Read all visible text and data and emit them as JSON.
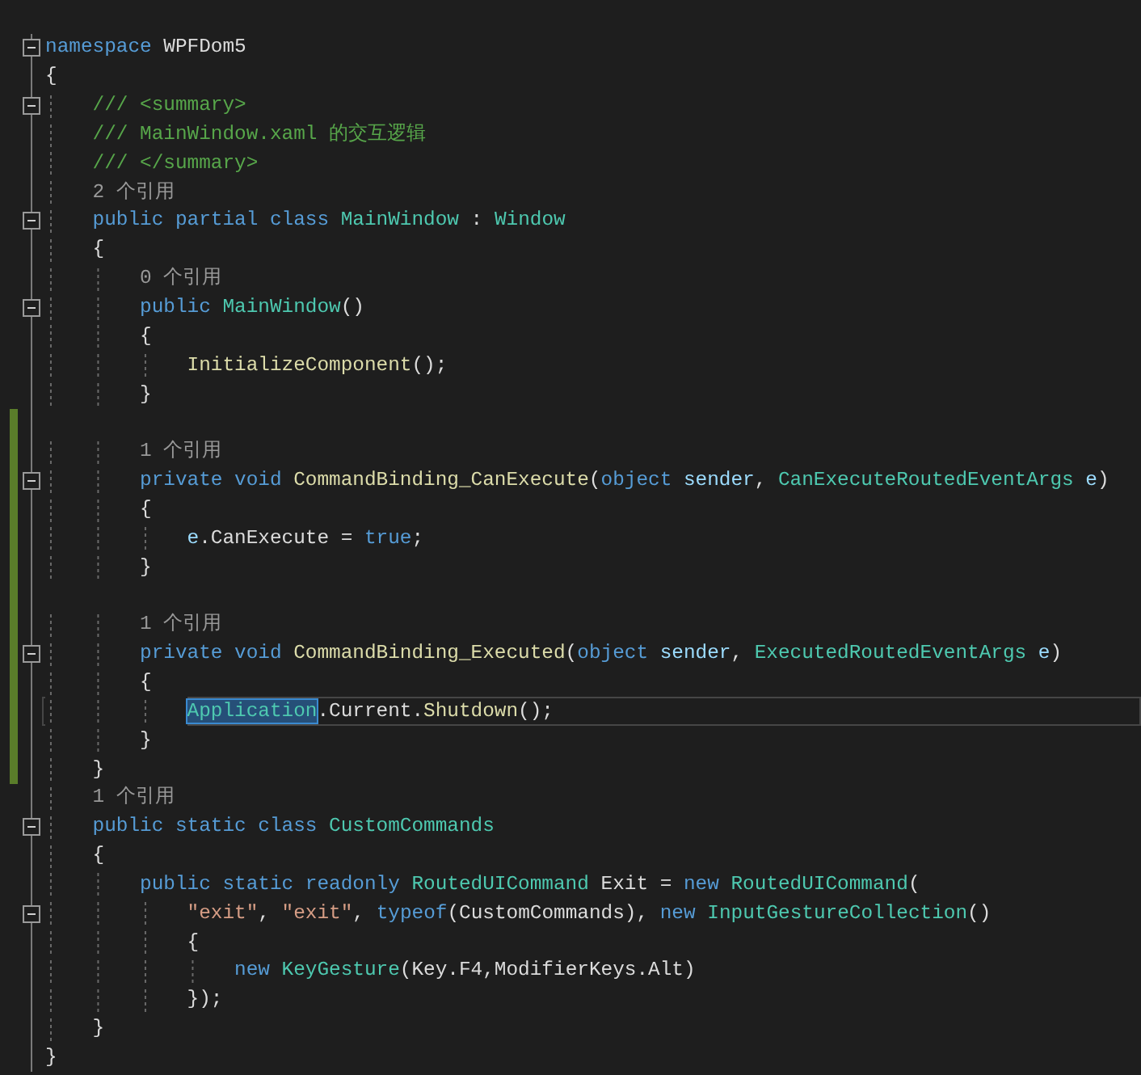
{
  "editor": {
    "lines": [
      {
        "fold": true,
        "changed": false,
        "current": false,
        "tokens": [
          {
            "kind": "kw",
            "text": "namespace"
          },
          {
            "kind": "plain",
            "text": " WPFDom5"
          }
        ]
      },
      {
        "fold": false,
        "changed": false,
        "current": false,
        "tokens": [
          {
            "kind": "plain",
            "text": "{"
          }
        ]
      },
      {
        "fold": true,
        "changed": false,
        "current": false,
        "tokens": [
          {
            "kind": "comment",
            "text": "    /// <summary>"
          }
        ]
      },
      {
        "fold": false,
        "changed": false,
        "current": false,
        "tokens": [
          {
            "kind": "comment",
            "text": "    /// MainWindow.xaml 的交互逻辑"
          }
        ]
      },
      {
        "fold": false,
        "changed": false,
        "current": false,
        "tokens": [
          {
            "kind": "comment",
            "text": "    /// </summary>"
          }
        ]
      },
      {
        "fold": false,
        "changed": false,
        "current": false,
        "tokens": [
          {
            "kind": "lens",
            "text": "    2 个引用"
          }
        ]
      },
      {
        "fold": true,
        "changed": false,
        "current": false,
        "tokens": [
          {
            "kind": "kw",
            "text": "    public partial class "
          },
          {
            "kind": "type",
            "text": "MainWindow"
          },
          {
            "kind": "plain",
            "text": " : "
          },
          {
            "kind": "type",
            "text": "Window"
          }
        ]
      },
      {
        "fold": false,
        "changed": false,
        "current": false,
        "tokens": [
          {
            "kind": "plain",
            "text": "    {"
          }
        ]
      },
      {
        "fold": false,
        "changed": false,
        "current": false,
        "tokens": [
          {
            "kind": "lens",
            "text": "        0 个引用"
          }
        ]
      },
      {
        "fold": true,
        "changed": false,
        "current": false,
        "tokens": [
          {
            "kind": "kw",
            "text": "        public "
          },
          {
            "kind": "type",
            "text": "MainWindow"
          },
          {
            "kind": "plain",
            "text": "()"
          }
        ]
      },
      {
        "fold": false,
        "changed": false,
        "current": false,
        "tokens": [
          {
            "kind": "plain",
            "text": "        {"
          }
        ]
      },
      {
        "fold": false,
        "changed": false,
        "current": false,
        "tokens": [
          {
            "kind": "method",
            "text": "            InitializeComponent"
          },
          {
            "kind": "plain",
            "text": "();"
          }
        ]
      },
      {
        "fold": false,
        "changed": false,
        "current": false,
        "tokens": [
          {
            "kind": "plain",
            "text": "        }"
          }
        ]
      },
      {
        "fold": false,
        "changed": true,
        "current": false
      },
      {
        "fold": false,
        "changed": true,
        "current": false,
        "tokens": [
          {
            "kind": "lens",
            "text": "        1 个引用"
          }
        ]
      },
      {
        "fold": true,
        "changed": true,
        "current": false,
        "tokens": [
          {
            "kind": "kw",
            "text": "        private void "
          },
          {
            "kind": "method",
            "text": "CommandBinding_CanExecute"
          },
          {
            "kind": "plain",
            "text": "("
          },
          {
            "kind": "kw",
            "text": "object "
          },
          {
            "kind": "param",
            "text": "sender"
          },
          {
            "kind": "plain",
            "text": ", "
          },
          {
            "kind": "type",
            "text": "CanExecuteRoutedEventArgs "
          },
          {
            "kind": "param",
            "text": "e"
          },
          {
            "kind": "plain",
            "text": ")"
          }
        ]
      },
      {
        "fold": false,
        "changed": true,
        "current": false,
        "tokens": [
          {
            "kind": "plain",
            "text": "        {"
          }
        ]
      },
      {
        "fold": false,
        "changed": true,
        "current": false,
        "tokens": [
          {
            "kind": "param",
            "text": "            e"
          },
          {
            "kind": "plain",
            "text": ".CanExecute = "
          },
          {
            "kind": "kw",
            "text": "true"
          },
          {
            "kind": "plain",
            "text": ";"
          }
        ]
      },
      {
        "fold": false,
        "changed": true,
        "current": false,
        "tokens": [
          {
            "kind": "plain",
            "text": "        }"
          }
        ]
      },
      {
        "fold": false,
        "changed": true,
        "current": false
      },
      {
        "fold": false,
        "changed": true,
        "current": false,
        "tokens": [
          {
            "kind": "lens",
            "text": "        1 个引用"
          }
        ]
      },
      {
        "fold": true,
        "changed": true,
        "current": false,
        "tokens": [
          {
            "kind": "kw",
            "text": "        private void "
          },
          {
            "kind": "method",
            "text": "CommandBinding_Executed"
          },
          {
            "kind": "plain",
            "text": "("
          },
          {
            "kind": "kw",
            "text": "object "
          },
          {
            "kind": "param",
            "text": "sender"
          },
          {
            "kind": "plain",
            "text": ", "
          },
          {
            "kind": "type",
            "text": "ExecutedRoutedEventArgs "
          },
          {
            "kind": "param",
            "text": "e"
          },
          {
            "kind": "plain",
            "text": ")"
          }
        ]
      },
      {
        "fold": false,
        "changed": true,
        "current": false,
        "tokens": [
          {
            "kind": "plain",
            "text": "        {"
          }
        ]
      },
      {
        "fold": false,
        "changed": true,
        "current": true,
        "tokens": [
          {
            "kind": "type",
            "text": "            Application",
            "highlighted": true
          },
          {
            "kind": "plain",
            "text": ".Current."
          },
          {
            "kind": "method",
            "text": "Shutdown"
          },
          {
            "kind": "plain",
            "text": "();"
          }
        ]
      },
      {
        "fold": false,
        "changed": true,
        "current": false,
        "tokens": [
          {
            "kind": "plain",
            "text": "        }"
          }
        ]
      },
      {
        "fold": false,
        "changed": true,
        "current": false,
        "tokens": [
          {
            "kind": "plain",
            "text": "    }"
          }
        ]
      },
      {
        "fold": false,
        "changed": false,
        "current": false,
        "tokens": [
          {
            "kind": "lens",
            "text": "    1 个引用"
          }
        ]
      },
      {
        "fold": true,
        "changed": false,
        "current": false,
        "tokens": [
          {
            "kind": "kw",
            "text": "    public static class "
          },
          {
            "kind": "type",
            "text": "CustomCommands"
          }
        ]
      },
      {
        "fold": false,
        "changed": false,
        "current": false,
        "tokens": [
          {
            "kind": "plain",
            "text": "    {"
          }
        ]
      },
      {
        "fold": false,
        "changed": false,
        "current": false,
        "tokens": [
          {
            "kind": "kw",
            "text": "        public static readonly "
          },
          {
            "kind": "type",
            "text": "RoutedUICommand"
          },
          {
            "kind": "plain",
            "text": " Exit = "
          },
          {
            "kind": "kw",
            "text": "new "
          },
          {
            "kind": "type",
            "text": "RoutedUICommand"
          },
          {
            "kind": "plain",
            "text": "("
          }
        ]
      },
      {
        "fold": true,
        "changed": false,
        "current": false,
        "tokens": [
          {
            "kind": "string",
            "text": "            \"exit\""
          },
          {
            "kind": "plain",
            "text": ", "
          },
          {
            "kind": "string",
            "text": "\"exit\""
          },
          {
            "kind": "plain",
            "text": ", "
          },
          {
            "kind": "kw",
            "text": "typeof"
          },
          {
            "kind": "plain",
            "text": "(CustomCommands), "
          },
          {
            "kind": "kw",
            "text": "new "
          },
          {
            "kind": "type",
            "text": "InputGestureCollection"
          },
          {
            "kind": "plain",
            "text": "()"
          }
        ]
      },
      {
        "fold": false,
        "changed": false,
        "current": false,
        "tokens": [
          {
            "kind": "plain",
            "text": "            {"
          }
        ]
      },
      {
        "fold": false,
        "changed": false,
        "current": false,
        "tokens": [
          {
            "kind": "kw",
            "text": "                new "
          },
          {
            "kind": "type",
            "text": "KeyGesture"
          },
          {
            "kind": "plain",
            "text": "(Key.F4,ModifierKeys.Alt)"
          }
        ]
      },
      {
        "fold": false,
        "changed": false,
        "current": false,
        "tokens": [
          {
            "kind": "plain",
            "text": "            });"
          }
        ]
      },
      {
        "fold": false,
        "changed": false,
        "current": false,
        "tokens": [
          {
            "kind": "plain",
            "text": "    }"
          }
        ]
      },
      {
        "fold": false,
        "changed": false,
        "current": false,
        "tokens": [
          {
            "kind": "plain",
            "text": "}"
          }
        ]
      }
    ]
  }
}
